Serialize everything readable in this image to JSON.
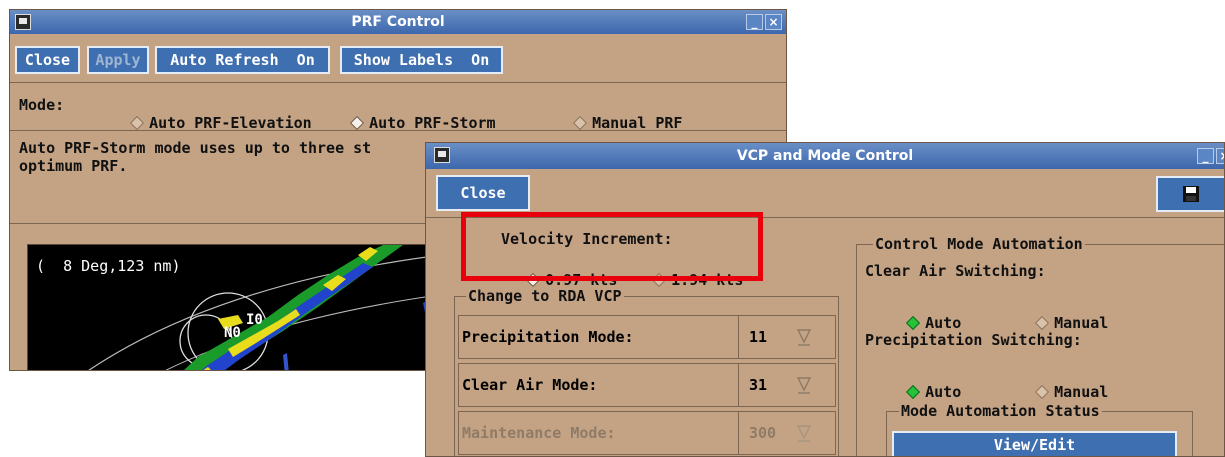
{
  "prf_window": {
    "title": "PRF Control",
    "toolbar": {
      "close": "Close",
      "apply": "Apply",
      "auto_refresh": "Auto Refresh  On",
      "show_labels": "Show Labels  On"
    },
    "mode_label": "Mode:",
    "modes": [
      {
        "label": "Auto PRF-Elevation",
        "selected": false
      },
      {
        "label": "Auto PRF-Storm",
        "selected": true
      },
      {
        "label": "Manual PRF",
        "selected": false
      }
    ],
    "description_line1": "Auto PRF-Storm mode uses up to three st",
    "description_line2": "optimum PRF.",
    "radar_readout": "(  8 Deg,123 nm)",
    "storm_labels": {
      "i0": "I0",
      "n0": "N0"
    },
    "window_controls": {
      "minimize": "_",
      "close": "×"
    }
  },
  "vcp_window": {
    "title": "VCP and Mode Control",
    "close": "Close",
    "window_controls": {
      "minimize": "_",
      "close": "×"
    },
    "velocity_increment": {
      "label": "Velocity Increment:",
      "options": [
        {
          "label": "0.97 kts",
          "selected": true
        },
        {
          "label": "1.94 kts",
          "selected": false
        }
      ]
    },
    "change_rda_vcp": {
      "title": "Change to RDA VCP",
      "rows": [
        {
          "label": "Precipitation Mode:",
          "value": "11",
          "enabled": true
        },
        {
          "label": "Clear Air Mode:",
          "value": "31",
          "enabled": true
        },
        {
          "label": "Maintenance Mode:",
          "value": "300",
          "enabled": false
        }
      ]
    },
    "control_mode_automation": {
      "title": "Control Mode Automation",
      "clear_air_label": "Clear Air Switching:",
      "clear_air_options": [
        {
          "label": "Auto",
          "selected": true
        },
        {
          "label": "Manual",
          "selected": false
        }
      ],
      "precip_label": "Precipitation Switching:",
      "precip_options": [
        {
          "label": "Auto",
          "selected": true
        },
        {
          "label": "Manual",
          "selected": false
        }
      ],
      "status_title": "Mode Automation Status",
      "view_edit": "View/Edit"
    }
  }
}
